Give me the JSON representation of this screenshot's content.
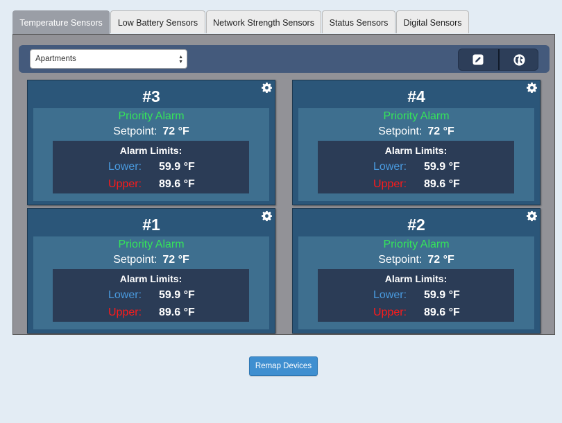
{
  "tabs": [
    {
      "label": "Temperature Sensors",
      "active": true
    },
    {
      "label": "Low Battery Sensors",
      "active": false
    },
    {
      "label": "Network Strength Sensors",
      "active": false
    },
    {
      "label": "Status Sensors",
      "active": false
    },
    {
      "label": "Digital Sensors",
      "active": false
    }
  ],
  "toolbar": {
    "location_select": "Apartments",
    "edit_icon": "pencil-icon",
    "map_icon": "globe-icon"
  },
  "sensors": [
    {
      "number": "#3",
      "status": "Priority Alarm",
      "setpoint_label": "Setpoint:",
      "setpoint": "72 °F",
      "limits_title": "Alarm Limits:",
      "lower_label": "Lower:",
      "lower": "59.9 °F",
      "upper_label": "Upper:",
      "upper": "89.6 °F"
    },
    {
      "number": "#4",
      "status": "Priority Alarm",
      "setpoint_label": "Setpoint:",
      "setpoint": "72 °F",
      "limits_title": "Alarm Limits:",
      "lower_label": "Lower:",
      "lower": "59.9 °F",
      "upper_label": "Upper:",
      "upper": "89.6 °F"
    },
    {
      "number": "#1",
      "status": "Priority Alarm",
      "setpoint_label": "Setpoint:",
      "setpoint": "72 °F",
      "limits_title": "Alarm Limits:",
      "lower_label": "Lower:",
      "lower": "59.9 °F",
      "upper_label": "Upper:",
      "upper": "89.6 °F"
    },
    {
      "number": "#2",
      "status": "Priority Alarm",
      "setpoint_label": "Setpoint:",
      "setpoint": "72 °F",
      "limits_title": "Alarm Limits:",
      "lower_label": "Lower:",
      "lower": "59.9 °F",
      "upper_label": "Upper:",
      "upper": "89.6 °F"
    }
  ],
  "colors": {
    "status_green": "#35e45a",
    "lower_blue": "#4a9be0",
    "upper_red": "#ff1a1a",
    "card_bg": "#2b5679"
  },
  "remap_button": "Remap Devices"
}
